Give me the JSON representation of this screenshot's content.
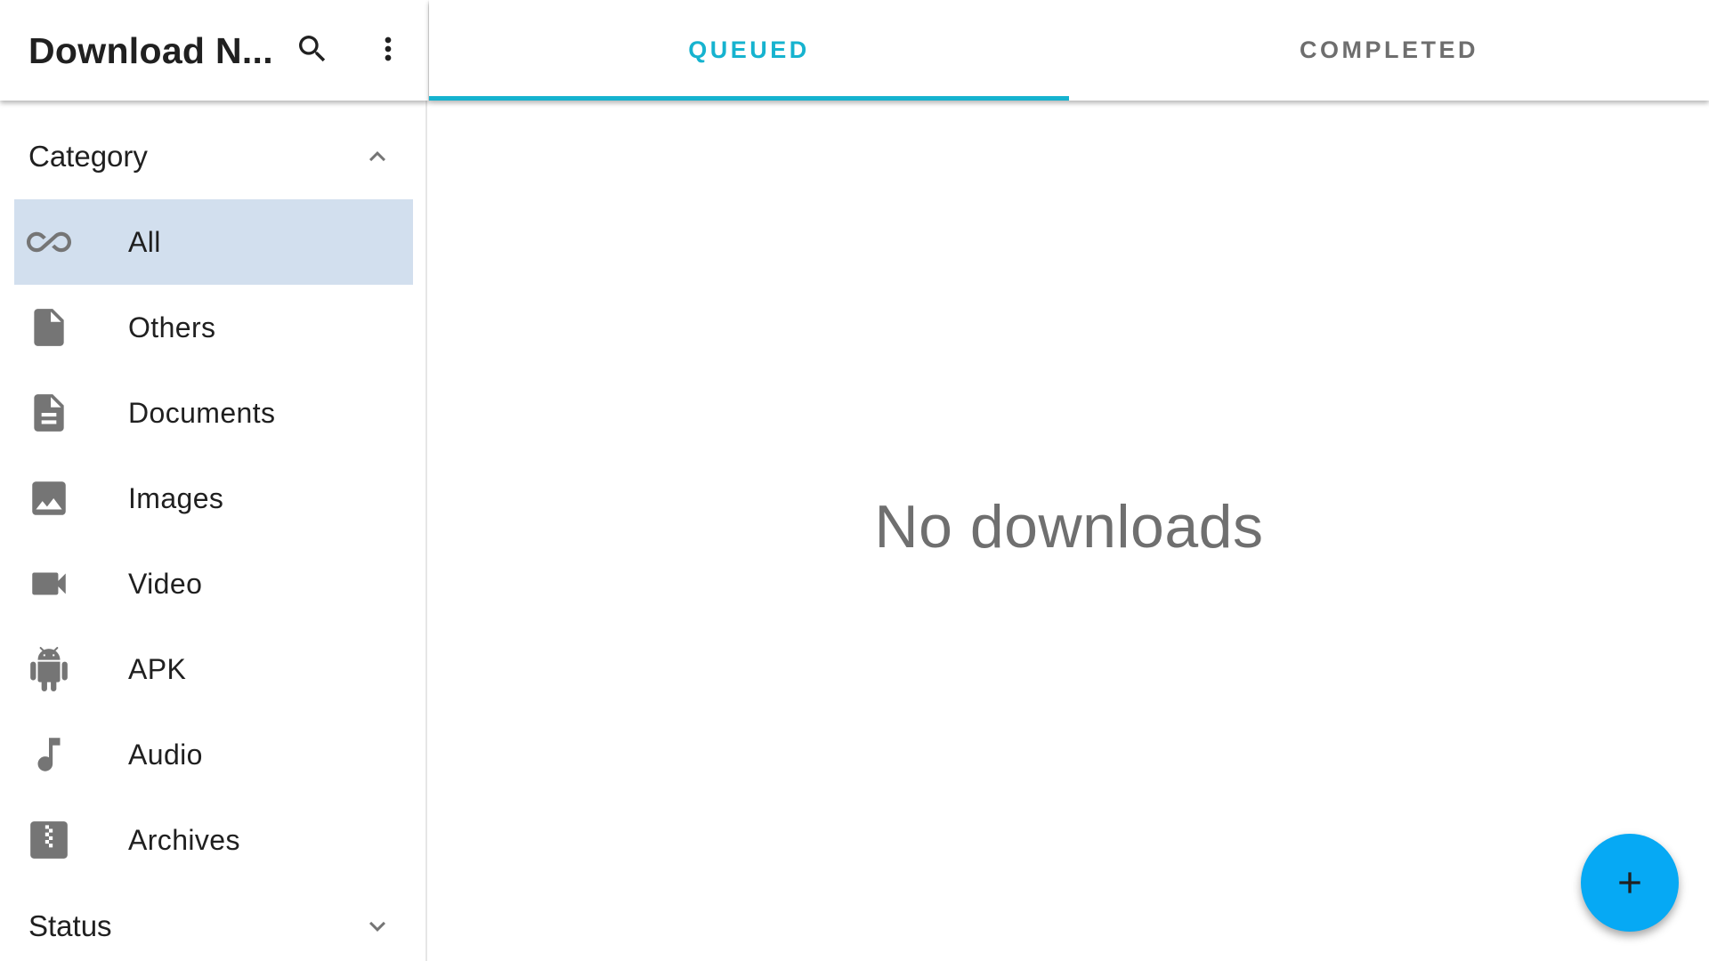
{
  "app_title": "Download N...",
  "toolbar": {
    "search_icon": "search-icon",
    "more_icon": "more-vert-icon"
  },
  "tabs": [
    {
      "label": "QUEUED",
      "active": true
    },
    {
      "label": "COMPLETED",
      "active": false
    }
  ],
  "sidebar": {
    "category_header": "Category",
    "category_expanded": true,
    "items": [
      {
        "label": "All",
        "icon": "infinity-icon",
        "selected": true
      },
      {
        "label": "Others",
        "icon": "file-icon",
        "selected": false
      },
      {
        "label": "Documents",
        "icon": "document-icon",
        "selected": false
      },
      {
        "label": "Images",
        "icon": "image-icon",
        "selected": false
      },
      {
        "label": "Video",
        "icon": "video-icon",
        "selected": false
      },
      {
        "label": "APK",
        "icon": "android-icon",
        "selected": false
      },
      {
        "label": "Audio",
        "icon": "music-note-icon",
        "selected": false
      },
      {
        "label": "Archives",
        "icon": "archive-icon",
        "selected": false
      }
    ],
    "status_header": "Status",
    "status_expanded": false
  },
  "main": {
    "empty_message": "No downloads",
    "fab_icon": "plus-icon"
  },
  "colors": {
    "accent": "#16b3cf",
    "fab": "#06a9f4",
    "selected_bg": "#d2dfee",
    "icon_gray": "#757575",
    "text_dark": "#202020",
    "text_muted": "#6f6f6f"
  }
}
